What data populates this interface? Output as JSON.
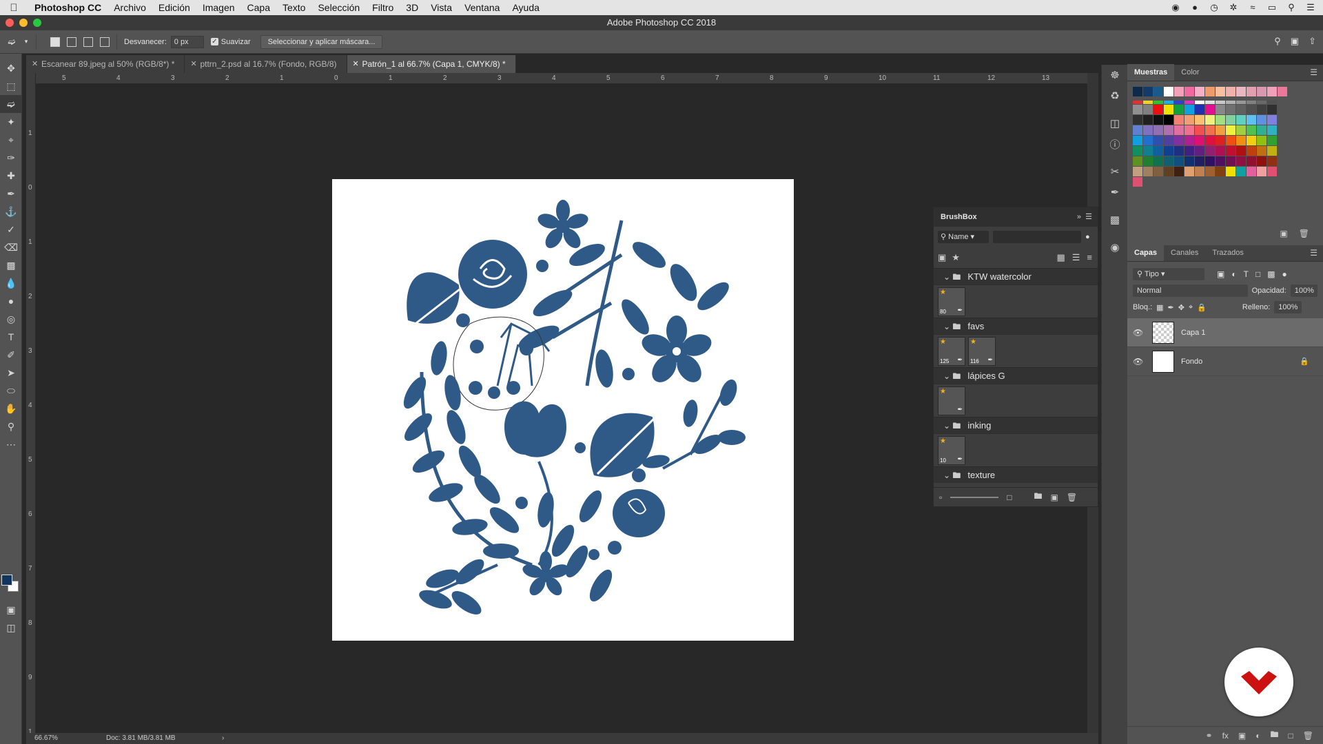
{
  "menubar": {
    "app": "Photoshop CC",
    "items": [
      "Archivo",
      "Edición",
      "Imagen",
      "Capa",
      "Texto",
      "Selección",
      "Filtro",
      "3D",
      "Vista",
      "Ventana",
      "Ayuda"
    ]
  },
  "window": {
    "title": "Adobe Photoshop CC 2018"
  },
  "options": {
    "feather_label": "Desvanecer:",
    "feather_value": "0 px",
    "smooth_label": "Suavizar",
    "mask_button": "Seleccionar y aplicar máscara..."
  },
  "tabs": [
    {
      "label": "Escanear 89.jpeg al 50% (RGB/8*) *"
    },
    {
      "label": "pttrn_2.psd al 16.7% (Fondo, RGB/8)"
    },
    {
      "label": "Patrón_1 al 66.7% (Capa 1, CMYK/8) *"
    }
  ],
  "ruler_h": [
    "5",
    "4",
    "3",
    "2",
    "1",
    "0",
    "1",
    "2",
    "3",
    "4",
    "5",
    "6",
    "7",
    "8",
    "9",
    "10",
    "11",
    "12",
    "13"
  ],
  "ruler_v": [
    "1",
    "0",
    "1",
    "2",
    "3",
    "4",
    "5",
    "6",
    "7",
    "8",
    "9",
    "1"
  ],
  "status": {
    "zoom": "66.67%",
    "doc": "Doc: 3.81 MB/3.81 MB",
    "arrow": "›"
  },
  "brushbox": {
    "title": "BrushBox",
    "sort": "Name",
    "groups": [
      {
        "name": "KTW watercolor",
        "thumbs": [
          "80"
        ]
      },
      {
        "name": "favs",
        "thumbs": [
          "125",
          "116"
        ]
      },
      {
        "name": "lápices G",
        "thumbs": [
          ""
        ]
      },
      {
        "name": "inking",
        "thumbs": [
          "10"
        ]
      },
      {
        "name": "texture",
        "thumbs": []
      }
    ]
  },
  "swatches_panel": {
    "tabs": [
      "Muestras",
      "Color"
    ]
  },
  "layers_panel": {
    "tabs": [
      "Capas",
      "Canales",
      "Trazados"
    ],
    "filter": "Tipo",
    "blend": "Normal",
    "opacity_label": "Opacidad:",
    "opacity_value": "100%",
    "lock_label": "Bloq.:",
    "fill_label": "Relleno:",
    "fill_value": "100%",
    "layers": [
      {
        "name": "Capa 1"
      },
      {
        "name": "Fondo"
      }
    ]
  },
  "colors": {
    "accent": "#10355f",
    "badge": "#cc1111"
  }
}
